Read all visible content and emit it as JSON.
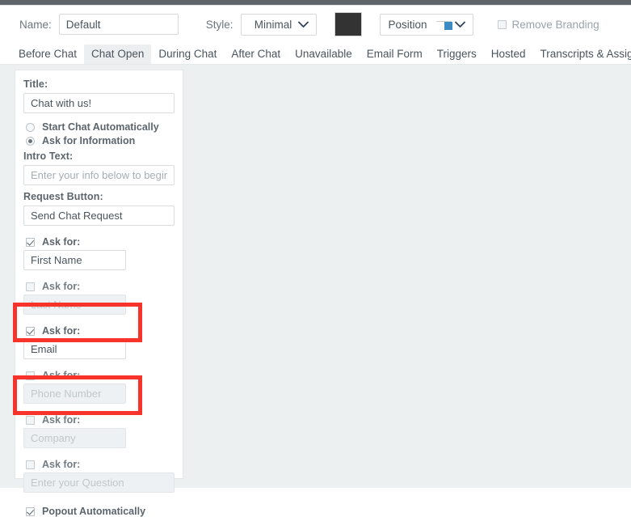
{
  "toolbar": {
    "name_label": "Name:",
    "name_value": "Default",
    "name_placeholder": "",
    "style_label": "Style:",
    "style_value": "Minimal",
    "color_swatch_hex": "#333333",
    "position_value": "Position",
    "remove_branding_label": "Remove Branding",
    "remove_branding_checked": false
  },
  "tabs": [
    {
      "label": "Before Chat",
      "active": false
    },
    {
      "label": "Chat Open",
      "active": true
    },
    {
      "label": "During Chat",
      "active": false
    },
    {
      "label": "After Chat",
      "active": false
    },
    {
      "label": "Unavailable",
      "active": false
    },
    {
      "label": "Email Form",
      "active": false
    },
    {
      "label": "Triggers",
      "active": false
    },
    {
      "label": "Hosted",
      "active": false
    },
    {
      "label": "Transcripts & Assignments",
      "active": false
    }
  ],
  "panel": {
    "title_label": "Title:",
    "title_value": "Chat with us!",
    "mode_auto_label": "Start Chat Automatically",
    "mode_ask_label": "Ask for Information",
    "intro_label": "Intro Text:",
    "intro_placeholder": "Enter your info below to begin.",
    "request_button_label": "Request Button:",
    "request_button_value": "Send Chat Request",
    "ask_label": "Ask for:",
    "ask_fields": [
      {
        "label": "Ask for:",
        "checked": true,
        "value": "First Name",
        "placeholder": "",
        "highlighted": true
      },
      {
        "label": "Ask for:",
        "checked": false,
        "value": "",
        "placeholder": "Last Name",
        "highlighted": false
      },
      {
        "label": "Ask for:",
        "checked": true,
        "value": "Email",
        "placeholder": "",
        "highlighted": true
      },
      {
        "label": "Ask for:",
        "checked": false,
        "value": "",
        "placeholder": "Phone Number",
        "highlighted": false
      },
      {
        "label": "Ask for:",
        "checked": false,
        "value": "",
        "placeholder": "Company",
        "highlighted": false
      },
      {
        "label": "Ask for:",
        "checked": false,
        "value": "",
        "placeholder": "Enter your Question",
        "highlighted": false
      }
    ],
    "popout_label": "Popout Automatically",
    "popout_checked": true
  },
  "colors": {
    "annotation": "#f8332c",
    "workspace_bg": "#edf0f1",
    "accent_blue": "#3b8cc4"
  }
}
